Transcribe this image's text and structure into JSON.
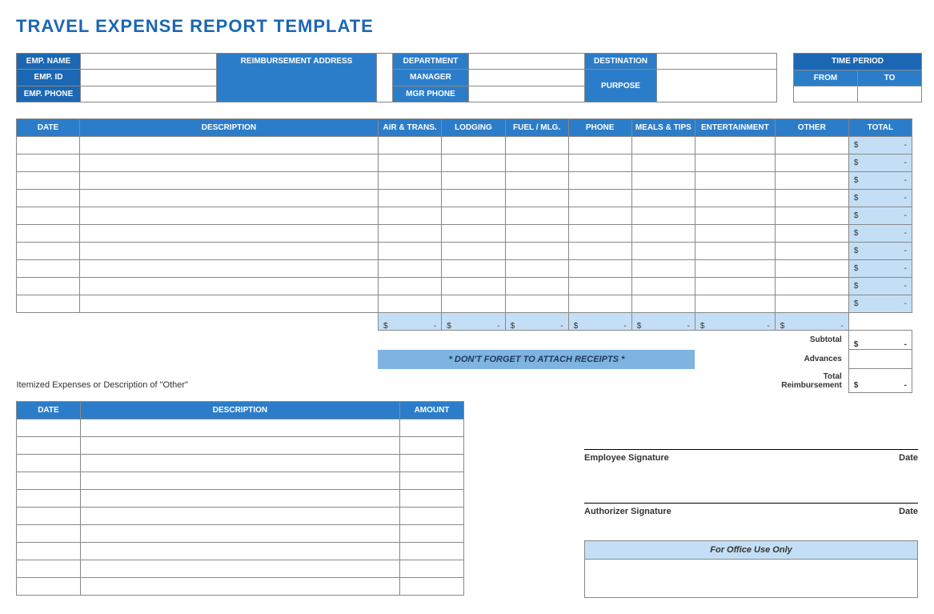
{
  "title": "TRAVEL EXPENSE REPORT TEMPLATE",
  "info": {
    "emp_name": "EMP. NAME",
    "emp_id": "EMP. ID",
    "emp_phone": "EMP. PHONE",
    "reimb_addr": "REIMBURSEMENT ADDRESS",
    "department": "DEPARTMENT",
    "manager": "MANAGER",
    "mgr_phone": "MGR PHONE",
    "destination": "DESTINATION",
    "purpose": "PURPOSE",
    "time_period": "TIME PERIOD",
    "from": "FROM",
    "to": "TO"
  },
  "cols": {
    "date": "DATE",
    "desc": "DESCRIPTION",
    "air": "AIR & TRANS.",
    "lodging": "LODGING",
    "fuel": "FUEL / MLG.",
    "phone": "PHONE",
    "meals": "MEALS & TIPS",
    "ent": "ENTERTAINMENT",
    "other": "OTHER",
    "total": "TOTAL",
    "amount": "AMOUNT"
  },
  "totals": {
    "dollar": "$",
    "dash": "-",
    "subtotal": "Subtotal",
    "advances": "Advances",
    "total_reimb": "Total Reimbursement"
  },
  "receipts_banner": "* DON'T FORGET TO ATTACH RECEIPTS *",
  "itemized_label": "Itemized Expenses or Description of \"Other\"",
  "sig": {
    "employee": "Employee Signature",
    "authorizer": "Authorizer Signature",
    "date": "Date"
  },
  "office": "For Office Use Only"
}
